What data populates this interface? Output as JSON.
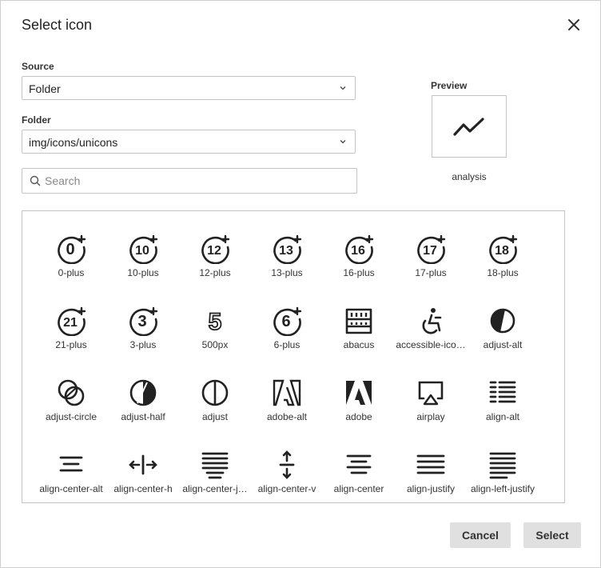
{
  "dialog": {
    "title": "Select icon",
    "close_icon": "close-icon"
  },
  "source": {
    "label": "Source",
    "value": "Folder"
  },
  "folder": {
    "label": "Folder",
    "value": "img/icons/unicons"
  },
  "search": {
    "placeholder": "Search",
    "value": ""
  },
  "preview": {
    "label": "Preview",
    "icon_name": "analysis"
  },
  "icons": [
    {
      "name": "0-plus",
      "caption": "0-plus",
      "glyph": "0"
    },
    {
      "name": "10-plus",
      "caption": "10-plus",
      "glyph": "10"
    },
    {
      "name": "12-plus",
      "caption": "12-plus",
      "glyph": "12"
    },
    {
      "name": "13-plus",
      "caption": "13-plus",
      "glyph": "13"
    },
    {
      "name": "16-plus",
      "caption": "16-plus",
      "glyph": "16"
    },
    {
      "name": "17-plus",
      "caption": "17-plus",
      "glyph": "17"
    },
    {
      "name": "18-plus",
      "caption": "18-plus",
      "glyph": "18"
    },
    {
      "name": "21-plus",
      "caption": "21-plus",
      "glyph": "21"
    },
    {
      "name": "3-plus",
      "caption": "3-plus",
      "glyph": "3"
    },
    {
      "name": "500px",
      "caption": "500px",
      "glyph": "5"
    },
    {
      "name": "6-plus",
      "caption": "6-plus",
      "glyph": "6"
    },
    {
      "name": "abacus",
      "caption": "abacus",
      "glyph": ""
    },
    {
      "name": "accessible-icon",
      "caption": "accessible-ico…",
      "glyph": ""
    },
    {
      "name": "adjust-alt",
      "caption": "adjust-alt",
      "glyph": ""
    },
    {
      "name": "adjust-circle",
      "caption": "adjust-circle",
      "glyph": ""
    },
    {
      "name": "adjust-half",
      "caption": "adjust-half",
      "glyph": ""
    },
    {
      "name": "adjust",
      "caption": "adjust",
      "glyph": ""
    },
    {
      "name": "adobe-alt",
      "caption": "adobe-alt",
      "glyph": ""
    },
    {
      "name": "adobe",
      "caption": "adobe",
      "glyph": ""
    },
    {
      "name": "airplay",
      "caption": "airplay",
      "glyph": ""
    },
    {
      "name": "align-alt",
      "caption": "align-alt",
      "glyph": ""
    },
    {
      "name": "align-center-alt",
      "caption": "align-center-alt",
      "glyph": ""
    },
    {
      "name": "align-center-h",
      "caption": "align-center-h",
      "glyph": ""
    },
    {
      "name": "align-center-justify",
      "caption": "align-center-j…",
      "glyph": ""
    },
    {
      "name": "align-center-v",
      "caption": "align-center-v",
      "glyph": ""
    },
    {
      "name": "align-center",
      "caption": "align-center",
      "glyph": ""
    },
    {
      "name": "align-justify",
      "caption": "align-justify",
      "glyph": ""
    },
    {
      "name": "align-left-justify",
      "caption": "align-left-justify",
      "glyph": ""
    }
  ],
  "buttons": {
    "cancel": "Cancel",
    "select": "Select"
  },
  "colors": {
    "icon": "#222222",
    "button_bg": "#e0e0e0",
    "border": "#c4c4c4"
  }
}
